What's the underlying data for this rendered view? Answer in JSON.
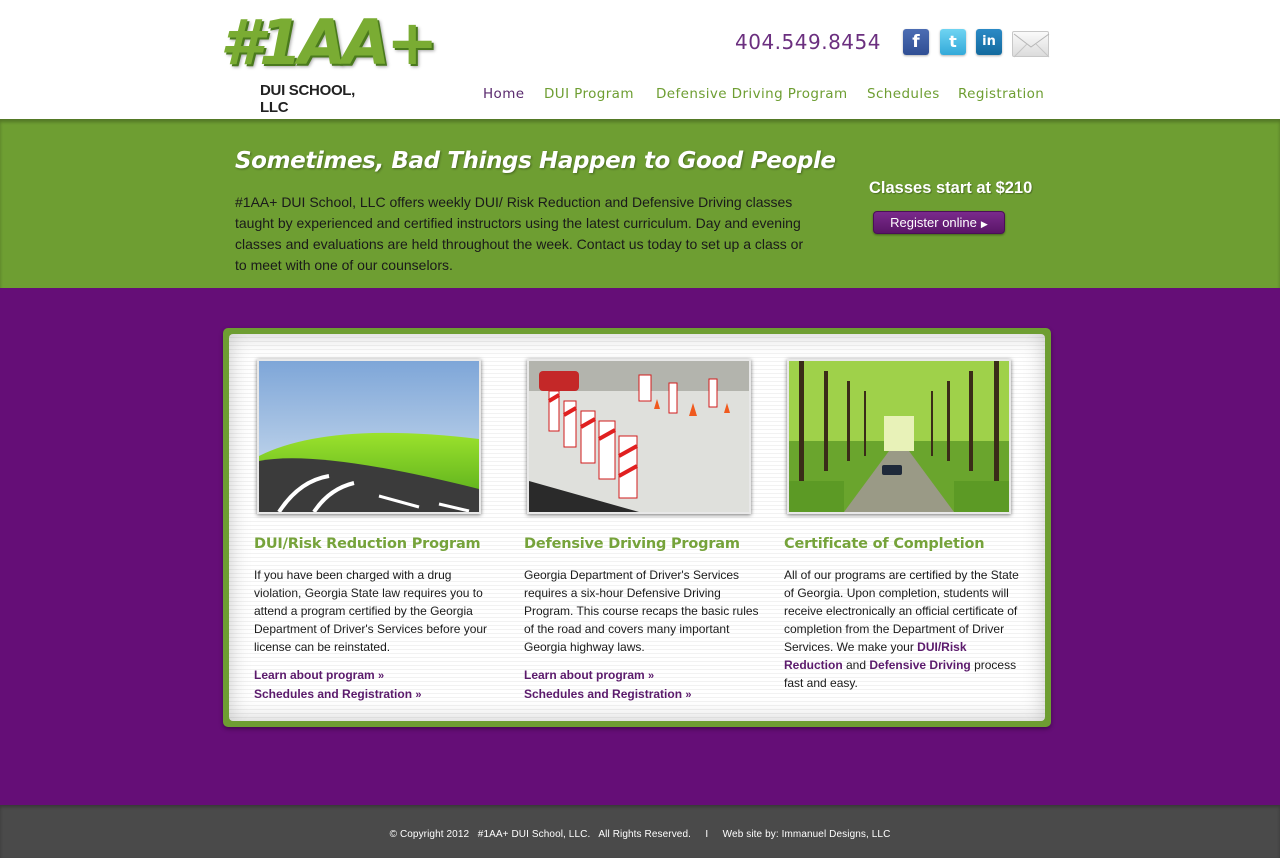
{
  "header": {
    "logo_main": "#1AA+",
    "logo_sub": "DUI SCHOOL, LLC",
    "phone": "404.549.8454",
    "social": [
      "facebook-icon",
      "twitter-icon",
      "linkedin-icon",
      "email-icon"
    ],
    "nav": [
      {
        "label": "Home",
        "active": true
      },
      {
        "label": "DUI Program"
      },
      {
        "label": "Defensive Driving Program"
      },
      {
        "label": "Schedules"
      },
      {
        "label": "Registration"
      }
    ]
  },
  "hero": {
    "title": "Sometimes, Bad Things Happen to Good People",
    "text": "#1AA+ DUI School, LLC offers weekly DUI/ Risk Reduction and Defensive Driving classes taught by experienced and certified instructors using the latest curriculum. Day and evening classes and evaluations are held throughout the week. Contact us today to set up a class or to meet with one of our counselors.",
    "price": "Classes start at $210",
    "register": "Register online"
  },
  "columns": [
    {
      "title": "DUI/Risk Reduction Program",
      "text": "If you have been charged with a drug violation, Georgia State law requires you to attend a program certified by the Georgia Department of Driver's Services before your license can be reinstated.",
      "link1": "Learn about program",
      "link2": "Schedules and Registration"
    },
    {
      "title": "Defensive Driving Program",
      "text": "Georgia Department of Driver's Services requires a six-hour Defensive Driving Program. This course recaps the basic rules of the road and covers many important Georgia highway laws.",
      "link1": "Learn about program",
      "link2": "Schedules and Registration"
    },
    {
      "title": "Certificate of Completion",
      "text_a": "All of our programs are certified by the State of Georgia. Upon completion, students will receive electronically an official certificate of completion from the Department of Driver Services. We make your ",
      "link_a": "DUI/Risk Reduction",
      "text_b": " and ",
      "link_b": "Defensive Driving",
      "text_c": " process fast and easy."
    }
  ],
  "footer": {
    "text": "© Copyright 2012   #1AA+ DUI School, LLC.   All Rights Reserved.     I     Web site by: Immanuel Designs, LLC"
  },
  "colors": {
    "green": "#6e9e32",
    "purple": "#650e77",
    "footer": "#4a4a4a"
  }
}
